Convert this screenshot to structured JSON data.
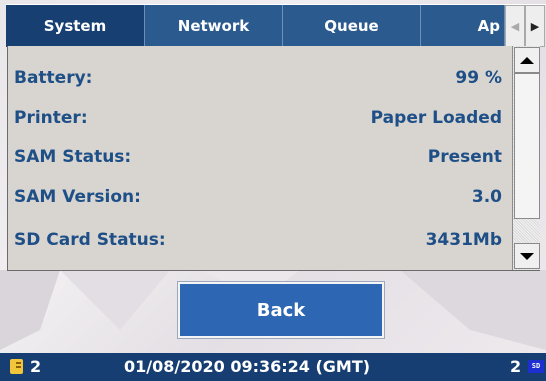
{
  "tabs": [
    {
      "label": "System",
      "active": true
    },
    {
      "label": "Network",
      "active": false
    },
    {
      "label": "Queue",
      "active": false
    },
    {
      "label": "Ap",
      "active": false
    }
  ],
  "tab_scroll": {
    "left_icon": "triangle-left-icon",
    "right_icon": "triangle-right-icon"
  },
  "info_rows": [
    {
      "label": "Battery:",
      "value": "99 %"
    },
    {
      "label": "Printer:",
      "value": "Paper Loaded"
    },
    {
      "label": "SAM Status:",
      "value": "Present"
    },
    {
      "label": "SAM Version:",
      "value": "3.0"
    },
    {
      "label": "SD Card Status:",
      "value": "3431Mb"
    }
  ],
  "back_button": {
    "label": "Back"
  },
  "status_bar": {
    "left_icon": "document-icon",
    "left_count": "2",
    "datetime": "01/08/2020 09:36:24 (GMT)",
    "right_count": "2",
    "sd_icon_label": "SD"
  },
  "colors": {
    "tab_bg": "#2b5a8e",
    "tab_active_bg": "#173f72",
    "row_text": "#1e4f86",
    "button_bg": "#2d66b3",
    "status_bar_bg": "#173e73"
  }
}
